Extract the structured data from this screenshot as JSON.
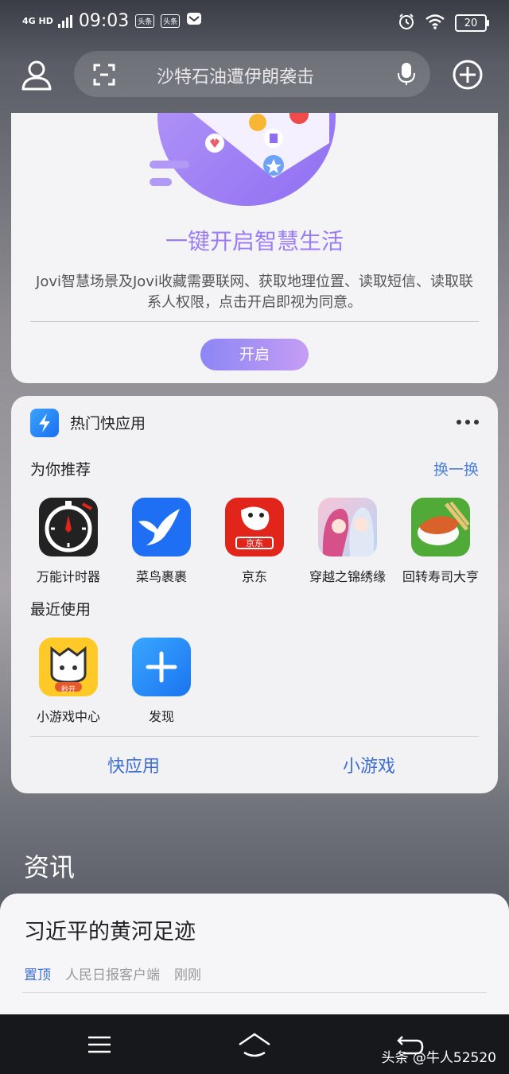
{
  "status_bar": {
    "network": "4G HD",
    "time": "09:03",
    "notif_badges": [
      "头条",
      "头条"
    ],
    "battery": "20"
  },
  "search": {
    "placeholder": "沙特石油遭伊朗袭击"
  },
  "jovi_card": {
    "headline": "一键开启智慧生活",
    "description": "Jovi智慧场景及Jovi收藏需要联网、获取地理位置、读取短信、读取联系人权限，点击开启即视为同意。",
    "button_label": "开启"
  },
  "quick_apps": {
    "title": "热门快应用",
    "recommend_title": "为你推荐",
    "refresh_label": "换一换",
    "recommended": [
      {
        "label": "万能计时器",
        "icon": "stopwatch-icon"
      },
      {
        "label": "菜鸟裹裹",
        "icon": "cainiao-bird-icon"
      },
      {
        "label": "京东",
        "icon": "jd-dog-icon"
      },
      {
        "label": "穿越之锦绣缘",
        "icon": "anime-couple-icon"
      },
      {
        "label": "回转寿司大亨",
        "icon": "sushi-icon"
      }
    ],
    "recent_title": "最近使用",
    "recent": [
      {
        "label": "小游戏中心",
        "icon": "game-cat-icon",
        "badge": "秒开"
      },
      {
        "label": "发现",
        "icon": "plus-icon"
      }
    ],
    "bottom_links": [
      "快应用",
      "小游戏"
    ]
  },
  "news": {
    "section_title": "资讯",
    "items": [
      {
        "title": "习近平的黄河足迹",
        "pin": "置顶",
        "source": "人民日报客户端",
        "time": "刚刚"
      }
    ]
  },
  "watermark": "头条 @牛人52520",
  "colors": {
    "accent_blue": "#3d6fd0",
    "jovi_purple": "#9b7cf5",
    "jd_red": "#e1251b"
  }
}
